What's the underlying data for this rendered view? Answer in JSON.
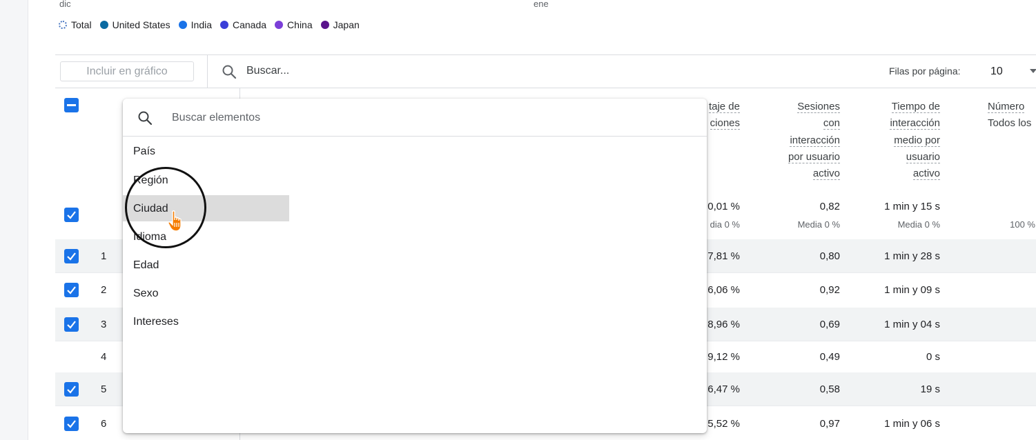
{
  "chart": {
    "x_labels": [
      "dic",
      "ene"
    ],
    "legend": [
      {
        "label": "Total",
        "color": "#4a78c2",
        "style": "dotted"
      },
      {
        "label": "United States",
        "color": "#0b6aa2"
      },
      {
        "label": "India",
        "color": "#1a73e8"
      },
      {
        "label": "Canada",
        "color": "#3b3fd8"
      },
      {
        "label": "China",
        "color": "#7b3fd8"
      },
      {
        "label": "Japan",
        "color": "#5a148c"
      }
    ]
  },
  "toolbar": {
    "include_label": "Incluir en gráfico",
    "search_placeholder": "Buscar...",
    "rows_per_page_label": "Filas por página:",
    "rows_per_page_value": "10"
  },
  "table": {
    "columns": [
      {
        "lines": [
          "taje de",
          "ciones"
        ]
      },
      {
        "lines": [
          "Sesiones",
          "con",
          "interacción",
          "por usuario",
          "activo"
        ]
      },
      {
        "lines": [
          "Tiempo de",
          "interacción",
          "medio por",
          "usuario",
          "activo"
        ]
      },
      {
        "lines": [
          "Número",
          "Todos los"
        ]
      }
    ],
    "totals": [
      {
        "value": "0,01 %",
        "sub": "dia 0 %"
      },
      {
        "value": "0,82",
        "sub": "Media 0 %"
      },
      {
        "value": "1 min y 15 s",
        "sub": "Media 0 %"
      },
      {
        "value": "",
        "sub": "100 %"
      }
    ],
    "rows": [
      {
        "num": "1",
        "checked": true,
        "c1": "7,81 %",
        "c2": "0,80",
        "c3": "1 min y 28 s"
      },
      {
        "num": "2",
        "checked": true,
        "c1": "6,06 %",
        "c2": "0,92",
        "c3": "1 min y 09 s"
      },
      {
        "num": "3",
        "checked": true,
        "c1": "8,96 %",
        "c2": "0,69",
        "c3": "1 min y 04 s"
      },
      {
        "num": "4",
        "checked": false,
        "c1": "9,12 %",
        "c2": "0,49",
        "c3": "0 s"
      },
      {
        "num": "5",
        "checked": true,
        "c1": "6,47 %",
        "c2": "0,58",
        "c3": "19 s"
      },
      {
        "num": "6",
        "checked": true,
        "c1": "5,52 %",
        "c2": "0,97",
        "c3": "1 min y 06 s"
      }
    ]
  },
  "dropdown": {
    "search_placeholder": "Buscar elementos",
    "items": [
      "País",
      "Región",
      "Ciudad",
      "Idioma",
      "Edad",
      "Sexo",
      "Intereses"
    ],
    "highlighted": "Ciudad"
  },
  "colors": {
    "accent": "#1a73e8",
    "cursor": "#f57c00"
  }
}
